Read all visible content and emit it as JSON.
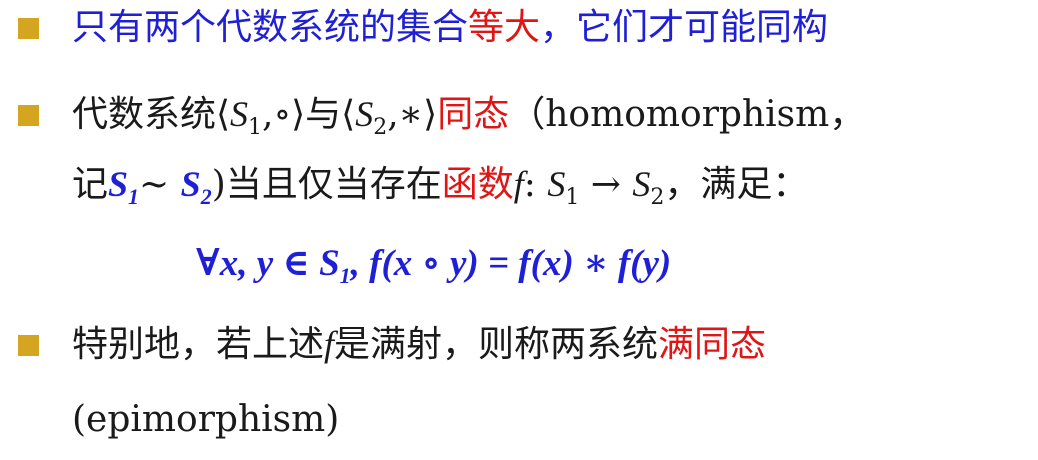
{
  "bullets": [
    {
      "a": "只有两个代数系统的集合",
      "b": "等大",
      "c": "，它们才可能同构"
    },
    {
      "p1": "代数系统⟨",
      "s": "S",
      "one": "1",
      "mid1": ",∘⟩与⟨",
      "two": "2",
      "mid2": ",∗⟩",
      "hom": "同态",
      "en": "（homomorphism，",
      "ji": "记",
      "tilde": "~ ",
      "p2": ")当且仅当存在",
      "func": "函数",
      "f": "f",
      "colon": ": ",
      "arrow": " → ",
      "end": "，满足："
    },
    {
      "a": "特别地，若上述",
      "f": "f",
      "b": "是满射，则称两系统",
      "c": "满同态",
      "d": "(epimorphism)"
    }
  ],
  "equation": {
    "forall": "∀",
    "vars": "x, y",
    "in": " ∈ ",
    "S": "S",
    "sub": "1",
    "rest": ", f(x ∘ y) = f(x) ∗ f(y)"
  },
  "colors": {
    "bullet": "#d4a520",
    "blue": "#1f1fd6",
    "red": "#e01616"
  }
}
